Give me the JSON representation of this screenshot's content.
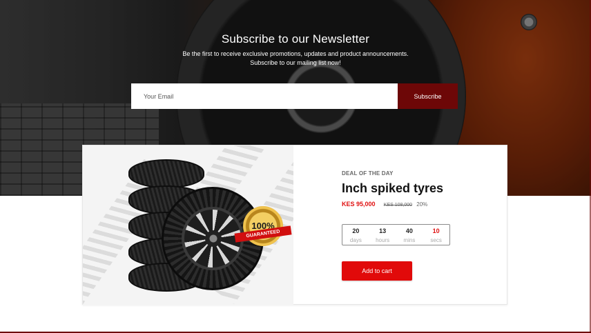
{
  "newsletter": {
    "title": "Subscribe to our Newsletter",
    "description_line1": "Be the first to receive exclusive promotions, updates and product announcements.",
    "description_line2": "Subscribe to our mailing list now!",
    "email_placeholder": "Your Email",
    "subscribe_label": "Subscribe"
  },
  "deal": {
    "label": "DEAL OF THE DAY",
    "title": "Inch spiked tyres",
    "price": "KES 95,000",
    "old_price": "KES 108,000",
    "discount": "20%",
    "badge_text": "100%",
    "badge_ribbon": "GUARANTEED",
    "countdown": [
      {
        "value": "20",
        "label": "days"
      },
      {
        "value": "13",
        "label": "hours"
      },
      {
        "value": "40",
        "label": "mins"
      },
      {
        "value": "10",
        "label": "secs"
      }
    ],
    "add_to_cart_label": "Add to cart"
  },
  "colors": {
    "subscribe_button": "#6d0707",
    "accent_red": "#e10a0a",
    "price_red": "#e01010"
  }
}
